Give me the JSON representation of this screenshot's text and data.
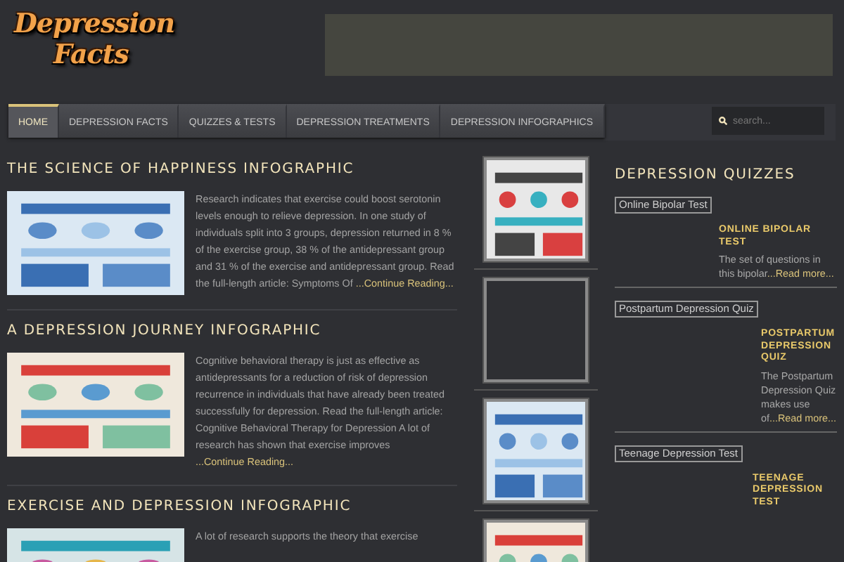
{
  "logo": {
    "lines": [
      "Depression",
      "Facts"
    ]
  },
  "nav": [
    {
      "label": "HOME",
      "selected": true
    },
    {
      "label": "DEPRESSION FACTS",
      "selected": false
    },
    {
      "label": "QUIZZES & TESTS",
      "selected": false
    },
    {
      "label": "DEPRESSION TREATMENTS",
      "selected": false
    },
    {
      "label": "DEPRESSION INFOGRAPHICS",
      "selected": false
    }
  ],
  "search": {
    "placeholder": "search..."
  },
  "articles": [
    {
      "title": "THE SCIENCE OF HAPPINESS INFOGRAPHIC",
      "excerpt": "Research indicates that exercise could boost serotonin levels enough to relieve depression. In one study of individuals split into 3 groups, depression returned in 8 % of the exercise group, 38 % of the antidepressant group and 31 % of the exercise and antidepressant group. Read the full-length article: Symptoms Of",
      "link": "...Continue Reading...",
      "image": {
        "kind": "picture"
      }
    },
    {
      "title": "A DEPRESSION JOURNEY INFOGRAPHIC",
      "excerpt": "Cognitive behavioral therapy is just as effective as antidepressants for a reduction of risk of depression recurrence in individuals that have already been treated successfully for depression. Read the full-length article: Cognitive Behavioral Therapy for Depression A lot of research has shown that exercise improves",
      "link": "...Continue Reading...",
      "image": {
        "kind": "picture"
      }
    },
    {
      "title": "EXERCISE AND DEPRESSION INFOGRAPHIC",
      "excerpt": "A lot of research supports the theory that exercise",
      "image": {
        "kind": "picture"
      }
    }
  ],
  "thumbnails": [
    {
      "kind": "picture"
    },
    {
      "kind": "empty"
    },
    {
      "kind": "picture"
    },
    {
      "kind": "picture"
    }
  ],
  "sidebar": {
    "title": "DEPRESSION QUIZZES",
    "quizzes": [
      {
        "alt": "Online Bipolar Test",
        "title": "ONLINE BIPOLAR TEST",
        "text": "The set of questions in this bipolar",
        "link": "...Read more..."
      },
      {
        "alt": "Postpartum Depression Quiz",
        "title": "POSTPARTUM DEPRESSION QUIZ",
        "text": "The Postpartum Depression Quiz makes use of",
        "link": "...Read more..."
      },
      {
        "alt": "Teenage Depression Test",
        "title": "TEENAGE DEPRESSION TEST"
      }
    ]
  }
}
